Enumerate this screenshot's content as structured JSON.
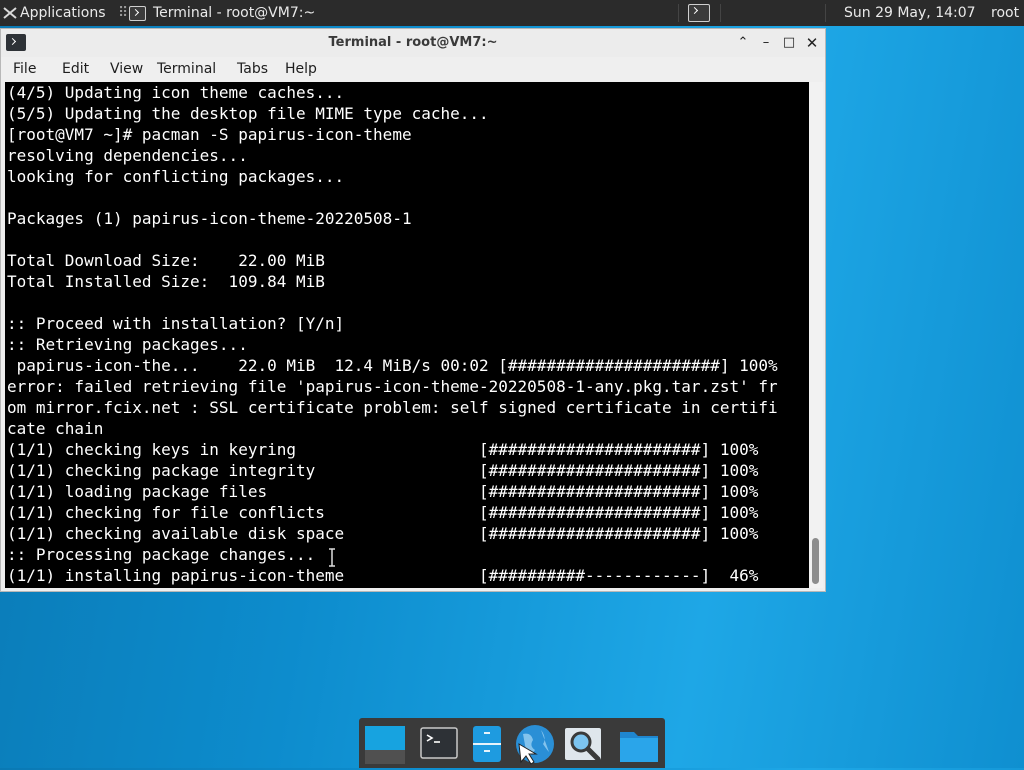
{
  "top_panel": {
    "applications_label": "Applications",
    "separator_glyph": "⠿",
    "task_label": "Terminal - root@VM7:~",
    "clock": "Sun 29 May, 14:07",
    "user": "root"
  },
  "window": {
    "title": "Terminal - root@VM7:~",
    "buttons": {
      "up": "⌃",
      "minimize": "–",
      "maximize": "□",
      "close": "✕"
    }
  },
  "menu": [
    "File",
    "Edit",
    "View",
    "Terminal",
    "Tabs",
    "Help"
  ],
  "terminal": {
    "lines": [
      "(4/5) Updating icon theme caches...",
      "(5/5) Updating the desktop file MIME type cache...",
      "[root@VM7 ~]# pacman -S papirus-icon-theme",
      "resolving dependencies...",
      "looking for conflicting packages...",
      "",
      "Packages (1) papirus-icon-theme-20220508-1",
      "",
      "Total Download Size:    22.00 MiB",
      "Total Installed Size:  109.84 MiB",
      "",
      ":: Proceed with installation? [Y/n]",
      ":: Retrieving packages...",
      " papirus-icon-the...    22.0 MiB  12.4 MiB/s 00:02 [######################] 100%",
      "error: failed retrieving file 'papirus-icon-theme-20220508-1-any.pkg.tar.zst' fr",
      "om mirror.fcix.net : SSL certificate problem: self signed certificate in certifi",
      "cate chain",
      "(1/1) checking keys in keyring                   [######################] 100%",
      "(1/1) checking package integrity                 [######################] 100%",
      "(1/1) loading package files                      [######################] 100%",
      "(1/1) checking for file conflicts                [######################] 100%",
      "(1/1) checking available disk space              [######################] 100%",
      ":: Processing package changes...",
      "(1/1) installing papirus-icon-theme              [##########------------]  46%"
    ]
  },
  "dock": {
    "items": [
      "desktop-icon",
      "terminal-icon",
      "file-manager-icon",
      "web-browser-icon",
      "app-finder-icon",
      "folder-icon"
    ]
  },
  "colors": {
    "desktop_accent": "#0d8ccd",
    "panel_bg": "#2b2b2b",
    "terminal_bg": "#000000",
    "terminal_fg": "#ffffff"
  }
}
